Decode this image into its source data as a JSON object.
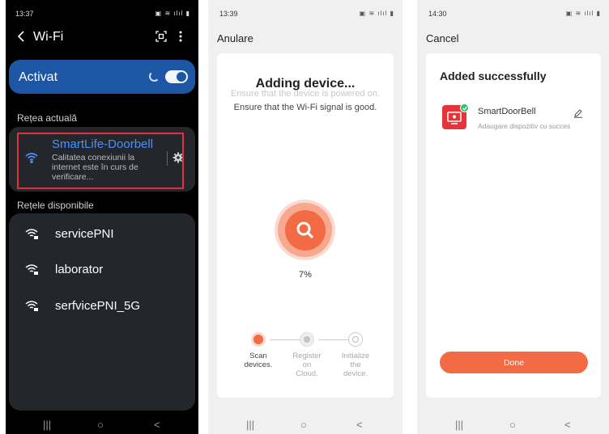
{
  "phone1": {
    "status_time": "13:37",
    "title": "Wi-Fi",
    "toggle_label": "Activat",
    "current_section": "Rețea actuală",
    "current_network": {
      "name": "SmartLife-Doorbell",
      "status_lines": [
        "Calitatea conexiunii la",
        "internet este în curs de",
        "verificare..."
      ]
    },
    "available_section": "Rețele disponibile",
    "available_networks": [
      "servicePNI",
      "laborator",
      "serfvicePNI_5G"
    ],
    "icons": [
      "back-icon",
      "qr-scan-icon",
      "more-icon",
      "spinner-icon",
      "wifi-icon",
      "gear-icon",
      "wifi-lock-icon"
    ]
  },
  "phone2": {
    "status_time": "13:39",
    "cancel_label": "Anulare",
    "title": "Adding device...",
    "hint_faded": "Ensure that the device is powered on.",
    "hint": "Ensure that the Wi-Fi signal is good.",
    "progress_text": "7%",
    "progress": 0.07,
    "steps": [
      {
        "label": [
          "Scan",
          "devices."
        ],
        "state": "active"
      },
      {
        "label": [
          "Register",
          "on",
          "Cloud."
        ],
        "state": "pending"
      },
      {
        "label": [
          "Initialize",
          "the",
          "device."
        ],
        "state": "pending"
      }
    ],
    "accent": "#f26b45"
  },
  "phone3": {
    "status_time": "14:30",
    "cancel_label": "Cancel",
    "title": "Added successfully",
    "device_name": "SmartDoorBell",
    "device_status": "Adaugare dispozitiv cu succes",
    "done_label": "Done",
    "accent": "#f26b45"
  },
  "nav": {
    "recents": "|||",
    "home": "○",
    "back": "<"
  }
}
